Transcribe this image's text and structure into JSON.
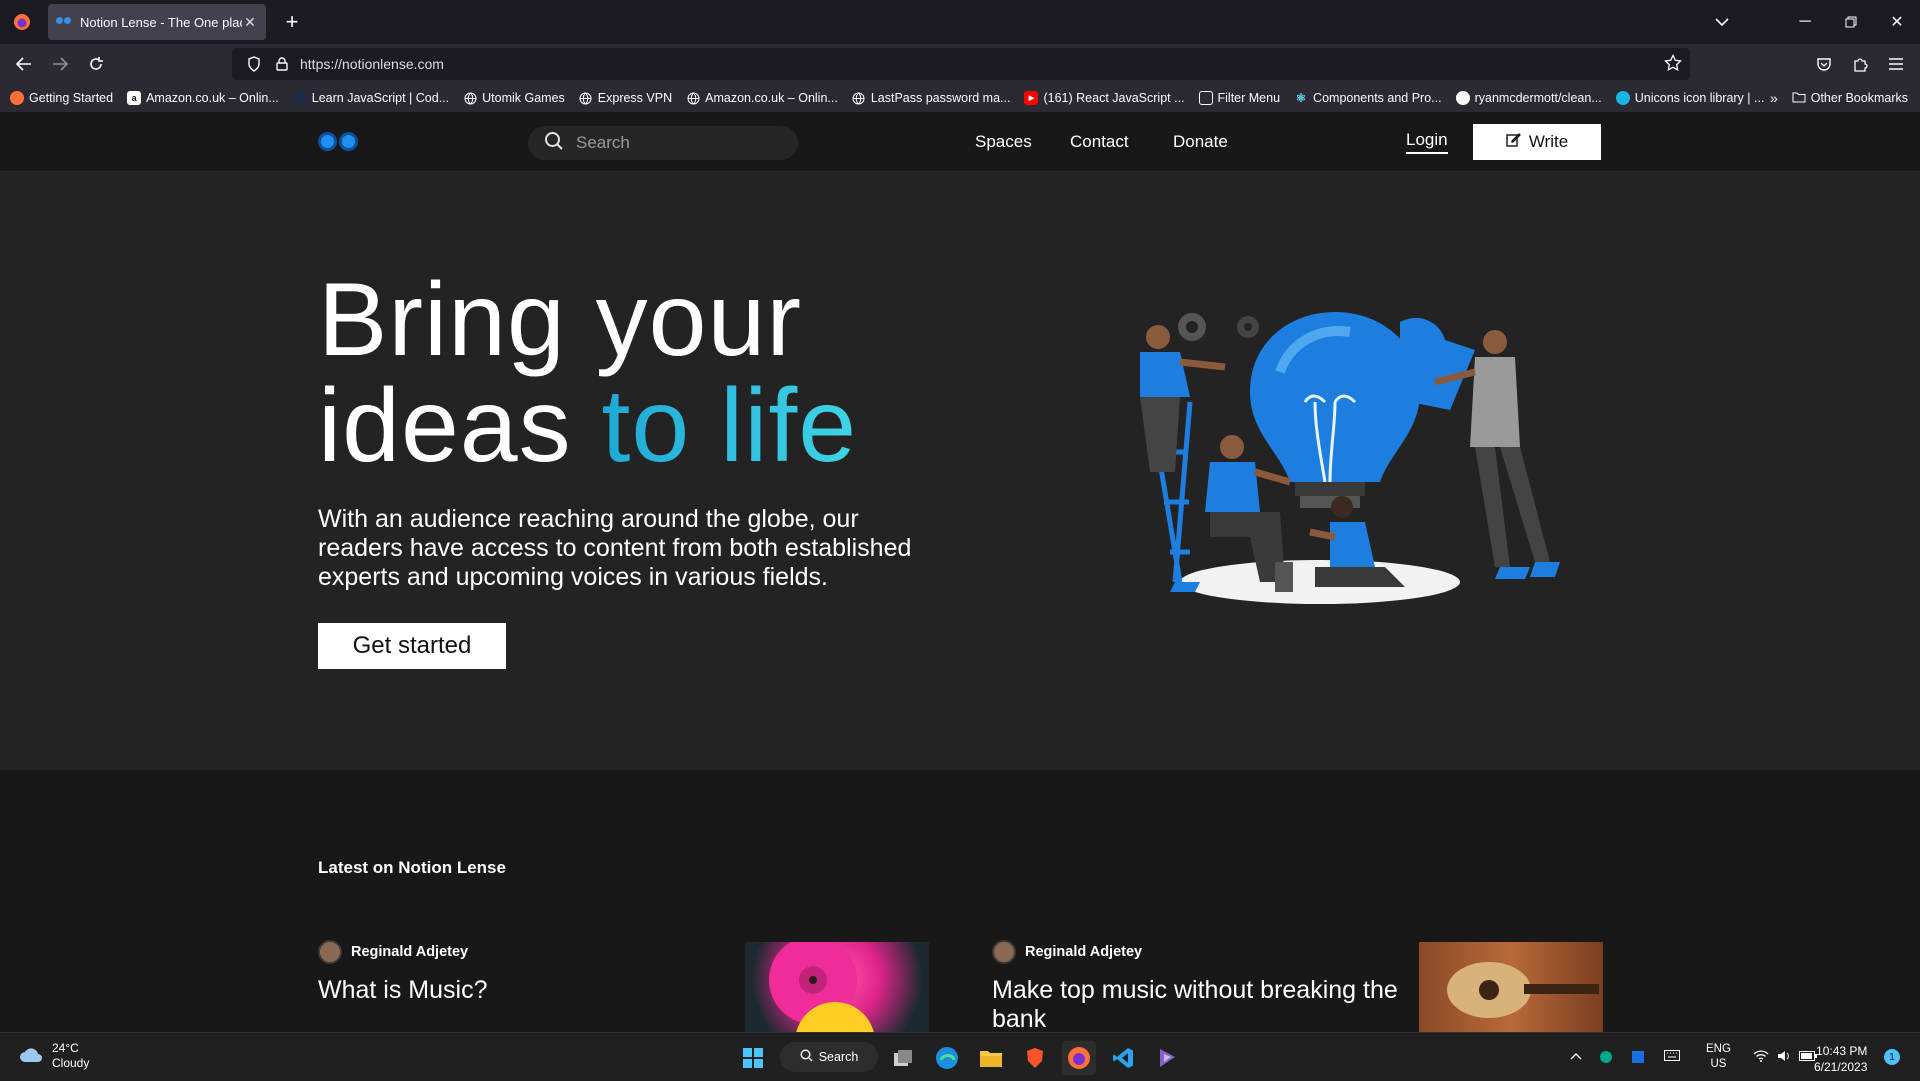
{
  "browser": {
    "tab_title": "Notion Lense - The One place to",
    "url": "https://notionlense.com",
    "bookmarks": [
      {
        "label": "Getting Started",
        "icon": "firefox-icon"
      },
      {
        "label": "Amazon.co.uk – Onlin...",
        "icon": "amazon-icon"
      },
      {
        "label": "Learn JavaScript | Cod...",
        "icon": "codecademy-icon"
      },
      {
        "label": "Utomik Games",
        "icon": "globe-icon"
      },
      {
        "label": "Express VPN",
        "icon": "globe-icon"
      },
      {
        "label": "Amazon.co.uk – Onlin...",
        "icon": "globe-icon"
      },
      {
        "label": "LastPass password ma...",
        "icon": "globe-icon"
      },
      {
        "label": "(161) React JavaScript ...",
        "icon": "youtube-icon"
      },
      {
        "label": "Filter Menu",
        "icon": "filter-icon"
      },
      {
        "label": "Components and Pro...",
        "icon": "react-icon"
      },
      {
        "label": "ryanmcdermott/clean...",
        "icon": "github-icon"
      },
      {
        "label": "Unicons icon library | ...",
        "icon": "unicons-icon"
      }
    ],
    "other_bookmarks": "Other Bookmarks"
  },
  "site": {
    "search_placeholder": "Search",
    "nav": {
      "spaces": "Spaces",
      "contact": "Contact",
      "donate": "Donate"
    },
    "login": "Login",
    "write": "Write"
  },
  "hero": {
    "line1": "Bring your",
    "line2a": "ideas ",
    "line2b": "to life",
    "paragraph": "With an audience reaching around the globe, our readers have access to content from both established experts and upcoming voices in various fields.",
    "cta": "Get started"
  },
  "latest": {
    "heading": "Latest on Notion Lense",
    "posts": [
      {
        "author": "Reginald Adjetey",
        "title": "What is Music?"
      },
      {
        "author": "Reginald Adjetey",
        "title": "Make top music without breaking the bank"
      }
    ]
  },
  "taskbar": {
    "temperature": "24°C",
    "weather": "Cloudy",
    "search": "Search",
    "lang1": "ENG",
    "lang2": "US",
    "time": "10:43 PM",
    "date": "6/21/2023",
    "notifications": "1"
  },
  "colors": {
    "accent": "#1f8ff0",
    "hero_accent": "#27bde0",
    "hero_bg": "#232323"
  }
}
